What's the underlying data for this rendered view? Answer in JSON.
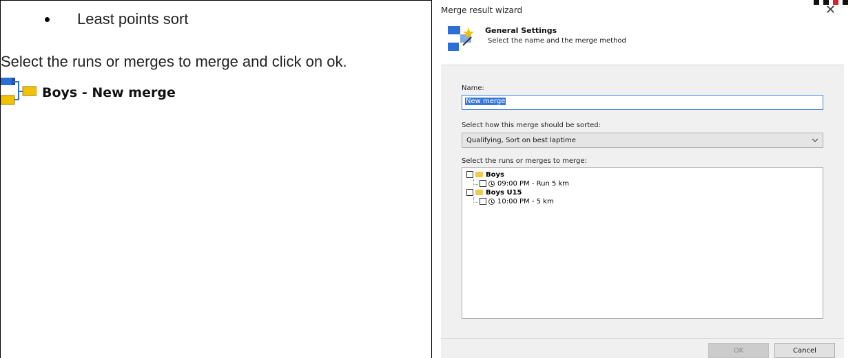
{
  "doc": {
    "bullet": "Least points sort",
    "paragraph": "Select the runs or merges to merge and click on ok.",
    "heading": "Boys - New merge"
  },
  "dialog": {
    "title": "Merge result wizard",
    "close_glyph": "✕",
    "header_title": "General Settings",
    "header_subtitle": "Select the name and the merge method",
    "name_label": "Name:",
    "name_value": "New merge",
    "sort_label": "Select how this merge should be sorted:",
    "sort_value": "Qualifying, Sort on best laptime",
    "tree_label": "Select the runs or merges to merge:",
    "tree": [
      {
        "label": "Boys",
        "child": "09:00 PM - Run 5 km"
      },
      {
        "label": "Boys U15",
        "child": "10:00 PM - 5 km"
      }
    ],
    "ok_label": "OK",
    "cancel_label": "Cancel"
  },
  "icons": {
    "merge": "merge-icon",
    "wizard": "wizard-icon",
    "folder": "folder-icon",
    "clock": "clock-icon",
    "chevron": "chevron-down-icon"
  },
  "colors": {
    "selection": "#3a78d6",
    "folder": "#f2c94c",
    "merge_blue": "#2b6fd6",
    "merge_yellow": "#f2c200"
  }
}
